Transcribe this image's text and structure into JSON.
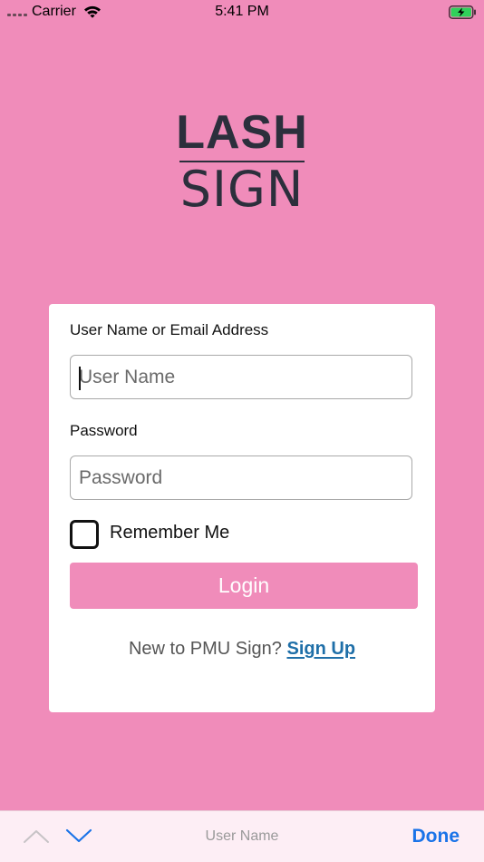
{
  "status_bar": {
    "carrier": "Carrier",
    "time": "5:41 PM"
  },
  "logo": {
    "top_text": "LASH",
    "bottom_text": "SIGN"
  },
  "login_form": {
    "username_label": "User Name or Email Address",
    "username_placeholder": "User Name",
    "password_label": "Password",
    "password_placeholder": "Password",
    "remember_label": "Remember Me",
    "remember_checked": false,
    "login_label": "Login",
    "signup_prompt": "New to PMU Sign?",
    "signup_link": "Sign Up"
  },
  "accessory_bar": {
    "field_name": "User Name",
    "done_label": "Done"
  },
  "colors": {
    "background": "#f08cba",
    "logo": "#2c2f3c",
    "link": "#1f6fa8",
    "done": "#1a73e8"
  },
  "icons": [
    "wifi-icon",
    "battery-charging-icon",
    "chevron-up-icon",
    "chevron-down-icon"
  ]
}
